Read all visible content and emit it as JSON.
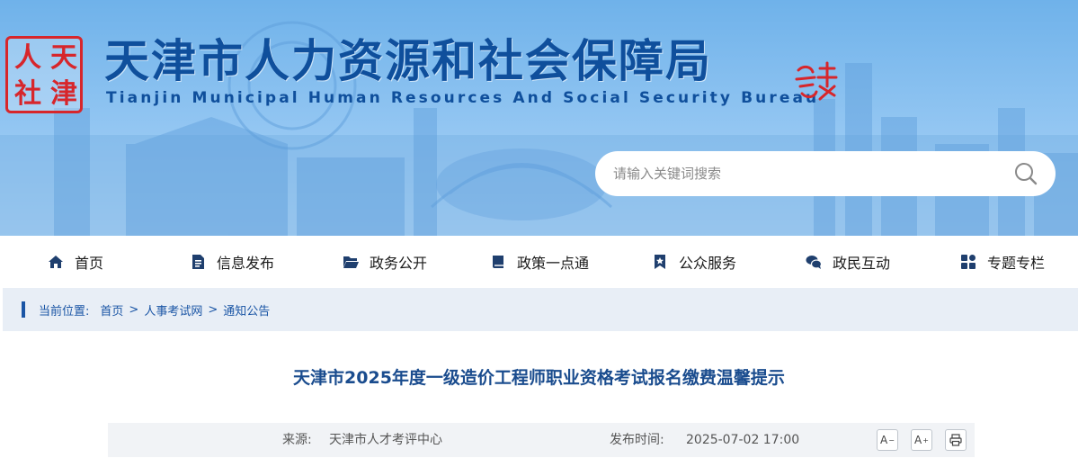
{
  "header": {
    "seal_chars": [
      "天",
      "人",
      "津",
      "社"
    ],
    "title": "天津市人力资源和社会保障局",
    "subtitle": "Tianjin Municipal Human Resources And Social Security Bureau",
    "brand_color": "#0f4f9c",
    "seal_color": "#d7262b"
  },
  "search": {
    "placeholder": "请输入关键词搜索",
    "icon": "search-icon"
  },
  "nav": {
    "items": [
      {
        "label": "首页",
        "icon": "home-icon"
      },
      {
        "label": "信息发布",
        "icon": "document-icon"
      },
      {
        "label": "政务公开",
        "icon": "folder-open-icon"
      },
      {
        "label": "政策一点通",
        "icon": "book-icon"
      },
      {
        "label": "公众服务",
        "icon": "bookmark-star-icon"
      },
      {
        "label": "政民互动",
        "icon": "chat-icon"
      },
      {
        "label": "专题专栏",
        "icon": "grid-icon"
      }
    ]
  },
  "breadcrumb": {
    "prefix": "当前位置:",
    "items": [
      "首页",
      "人事考试网",
      "通知公告"
    ],
    "separator": ">"
  },
  "article": {
    "title": "天津市2025年度一级造价工程师职业资格考试报名缴费温馨提示",
    "source_label": "来源:",
    "source": "天津市人才考评中心",
    "publish_label": "发布时间:",
    "publish_time": "2025-07-02 17:00",
    "font_decrease": "A",
    "font_increase": "A",
    "accent_color": "#1a4c8e"
  }
}
